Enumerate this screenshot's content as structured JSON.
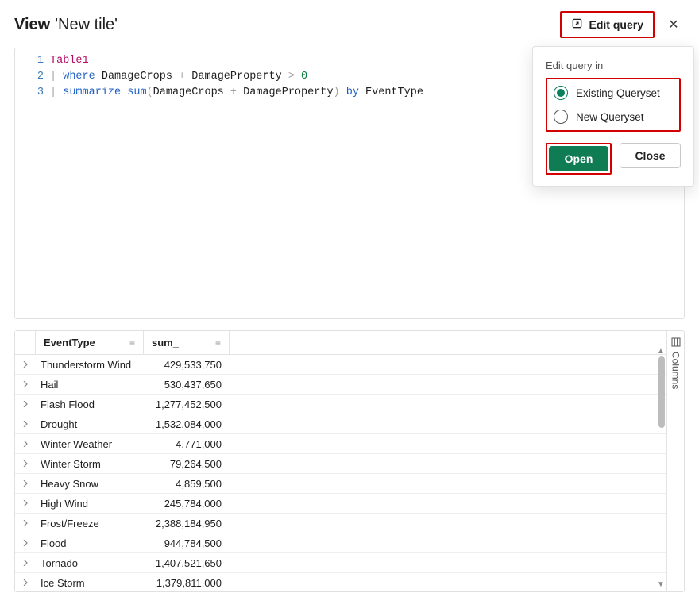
{
  "header": {
    "view_label": "View",
    "tile_name": "'New tile'",
    "edit_query_label": "Edit query"
  },
  "code": {
    "lines": [
      1,
      2,
      3
    ],
    "table_token": "Table1",
    "pipe": "|",
    "where_kw": "where",
    "damage_crops": "DamageCrops",
    "plus": "+",
    "damage_property": "DamageProperty",
    "gt": ">",
    "zero": "0",
    "summarize_kw": "summarize",
    "sum_fn": "sum",
    "lparen": "(",
    "rparen": ")",
    "by_kw": "by",
    "event_type": "EventType"
  },
  "popup": {
    "label": "Edit query in",
    "option_existing": "Existing Queryset",
    "option_new": "New Queryset",
    "open_label": "Open",
    "close_label": "Close"
  },
  "table": {
    "col_event": "EventType",
    "col_sum": "sum_",
    "columns_tab": "Columns",
    "rows": [
      {
        "event": "Thunderstorm Wind",
        "sum": "429,533,750"
      },
      {
        "event": "Hail",
        "sum": "530,437,650"
      },
      {
        "event": "Flash Flood",
        "sum": "1,277,452,500"
      },
      {
        "event": "Drought",
        "sum": "1,532,084,000"
      },
      {
        "event": "Winter Weather",
        "sum": "4,771,000"
      },
      {
        "event": "Winter Storm",
        "sum": "79,264,500"
      },
      {
        "event": "Heavy Snow",
        "sum": "4,859,500"
      },
      {
        "event": "High Wind",
        "sum": "245,784,000"
      },
      {
        "event": "Frost/Freeze",
        "sum": "2,388,184,950"
      },
      {
        "event": "Flood",
        "sum": "944,784,500"
      },
      {
        "event": "Tornado",
        "sum": "1,407,521,650"
      },
      {
        "event": "Ice Storm",
        "sum": "1,379,811,000"
      }
    ]
  }
}
